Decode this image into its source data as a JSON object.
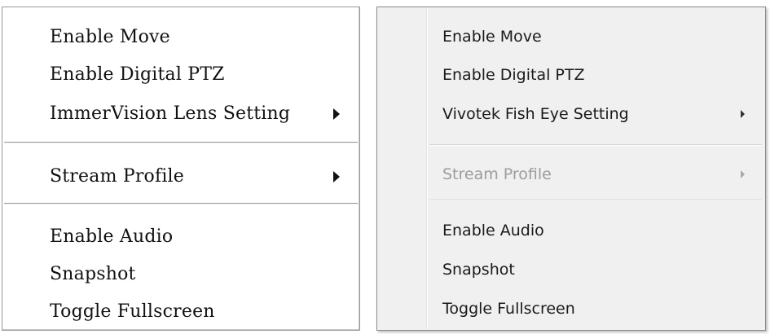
{
  "left_menu": {
    "items": [
      {
        "label": "Enable Move"
      },
      {
        "label": "Enable Digital PTZ"
      },
      {
        "label": "ImmerVision Lens Setting"
      },
      {
        "label": "Stream Profile"
      },
      {
        "label": "Enable Audio"
      },
      {
        "label": "Snapshot"
      },
      {
        "label": "Toggle Fullscreen"
      }
    ]
  },
  "right_menu": {
    "items": [
      {
        "label": "Enable Move"
      },
      {
        "label": "Enable Digital PTZ"
      },
      {
        "label": "Vivotek Fish Eye Setting"
      },
      {
        "label": "Stream Profile",
        "state": "disabled"
      },
      {
        "label": "Enable Audio"
      },
      {
        "label": "Snapshot"
      },
      {
        "label": "Toggle Fullscreen"
      }
    ]
  },
  "icons": {
    "submenu_arrow": "submenu-arrow-icon"
  }
}
